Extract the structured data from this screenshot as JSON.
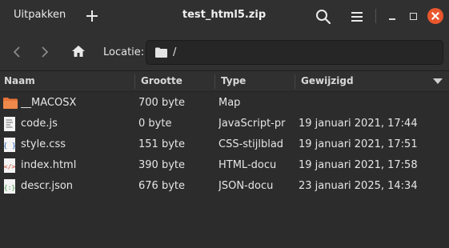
{
  "header": {
    "extract_label": "Uitpakken",
    "title": "test_html5.zip"
  },
  "toolbar": {
    "location_label": "Locatie:",
    "location_path": "/"
  },
  "columns": {
    "name": "Naam",
    "size": "Grootte",
    "type": "Type",
    "modified": "Gewijzigd"
  },
  "files": [
    {
      "name": "__MACOSX",
      "size": "700 byte",
      "type": "Map",
      "modified": "",
      "icon": "folder-icon"
    },
    {
      "name": "code.js",
      "size": "0 byte",
      "type": "JavaScript-pr",
      "modified": "19 januari 2021, 17:44",
      "icon": "text-file-icon"
    },
    {
      "name": "style.css",
      "size": "151 byte",
      "type": "CSS-stijlblad",
      "modified": "19 januari 2021, 17:51",
      "icon": "css-file-icon"
    },
    {
      "name": "index.html",
      "size": "390 byte",
      "type": "HTML-docu",
      "modified": "19 januari 2021, 17:58",
      "icon": "html-file-icon"
    },
    {
      "name": "descr.json",
      "size": "676 byte",
      "type": "JSON-docu",
      "modified": "23 januari 2025, 14:34",
      "icon": "json-file-icon"
    }
  ],
  "colors": {
    "accent_close": "#e9572d",
    "folder": "#f08a4b",
    "background": "#2c2c2c",
    "headerbar": "#303030"
  }
}
